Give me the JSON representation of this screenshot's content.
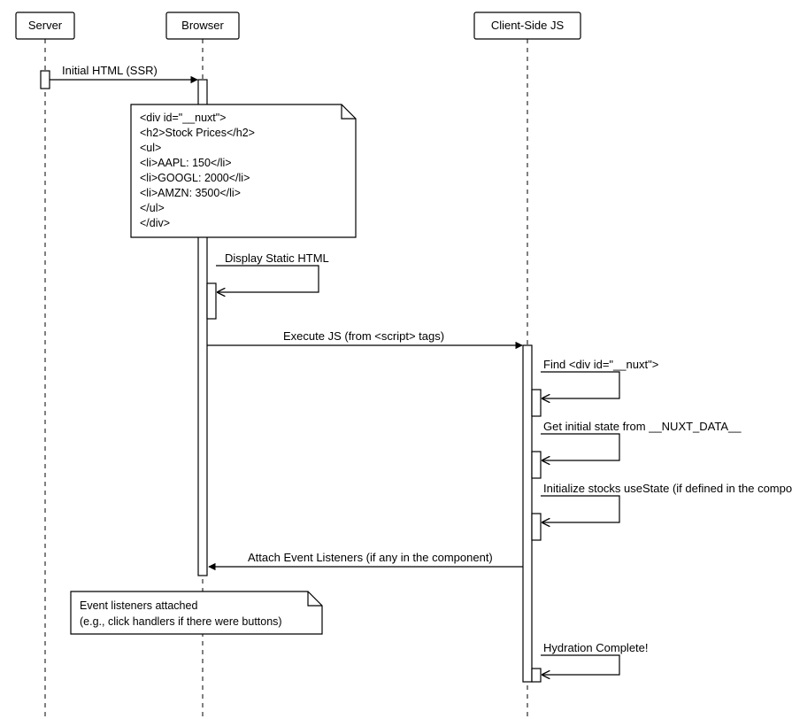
{
  "participants": {
    "server": "Server",
    "browser": "Browser",
    "client_js": "Client-Side JS"
  },
  "messages": {
    "initial_html": "Initial HTML (SSR)",
    "display_static": "Display Static HTML",
    "execute_js": "Execute JS (from <script> tags)",
    "find_div": "Find <div id=\"__nuxt\">",
    "get_state": "Get initial state from __NUXT_DATA__",
    "init_stocks": "Initialize stocks useState (if defined in the component)",
    "attach_listeners": "Attach Event Listeners (if any in the component)",
    "hydration_complete": "Hydration Complete!"
  },
  "note_ssr_lines": [
    "<div id=\"__nuxt\">",
    "  <h2>Stock Prices</h2>",
    "  <ul>",
    "    <li>AAPL: 150</li>",
    "    <li>GOOGL: 2000</li>",
    "    <li>AMZN: 3500</li>",
    "  </ul>",
    "</div>"
  ],
  "note_event_lines": [
    "Event listeners attached",
    "(e.g., click handlers if there were buttons)"
  ]
}
